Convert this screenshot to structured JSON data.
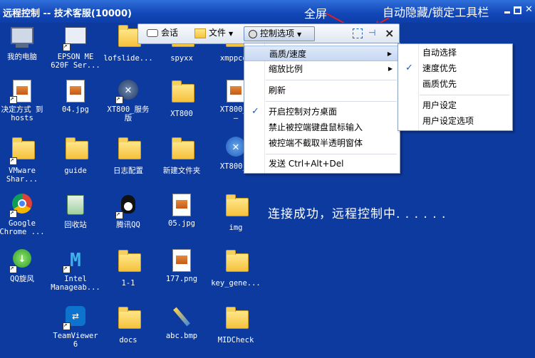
{
  "window": {
    "title": "远程控制 -- 技术客服(10000)"
  },
  "annotations": {
    "fullscreen": "全屏",
    "auto_hide": "自动隐藏/锁定工具栏"
  },
  "toolbar": {
    "chat": "会话",
    "file": "文件",
    "control_options": "控制选项"
  },
  "menu": {
    "items": [
      {
        "label": "画质/速度"
      },
      {
        "label": "缩放比例"
      },
      {
        "label": "刷新"
      },
      {
        "label": "开启控制对方桌面"
      },
      {
        "label": "禁止被控端键盘鼠标输入"
      },
      {
        "label": "被控端不截取半透明窗体"
      },
      {
        "label": "发送 Ctrl+Alt+Del"
      }
    ]
  },
  "submenu": {
    "items": [
      {
        "label": "自动选择"
      },
      {
        "label": "速度优先"
      },
      {
        "label": "画质优先"
      },
      {
        "label": "用户设定"
      },
      {
        "label": "用户设定选项"
      }
    ]
  },
  "status_message": "连接成功，远程控制中. . . . . .",
  "desktop_icons": [
    {
      "label": "我的电脑"
    },
    {
      "label": "EPSON ME\n620F Ser..."
    },
    {
      "label": "lofslide..."
    },
    {
      "label": "spyxx"
    },
    {
      "label": "xmppcor"
    },
    {
      "label": "决定方式 到\nhosts"
    },
    {
      "label": "04.jpg"
    },
    {
      "label": "XT800_服务\n版"
    },
    {
      "label": "XT800"
    },
    {
      "label": "XT800_E\n—"
    },
    {
      "label": "VMware\nShar..."
    },
    {
      "label": "guide"
    },
    {
      "label": "日志配置"
    },
    {
      "label": "新建文件夹"
    },
    {
      "label": "XT800_m"
    },
    {
      "label": "Google\nChrome ..."
    },
    {
      "label": "回收站"
    },
    {
      "label": "腾讯QQ"
    },
    {
      "label": "05.jpg"
    },
    {
      "label": "img"
    },
    {
      "label": "QQ旋风"
    },
    {
      "label": "Intel\nManageab..."
    },
    {
      "label": "1-1"
    },
    {
      "label": "177.png"
    },
    {
      "label": "key_gene..."
    },
    {
      "label": "TeamViewer\n6"
    },
    {
      "label": "docs"
    },
    {
      "label": "abc.bmp"
    },
    {
      "label": "MIDCheck"
    }
  ]
}
